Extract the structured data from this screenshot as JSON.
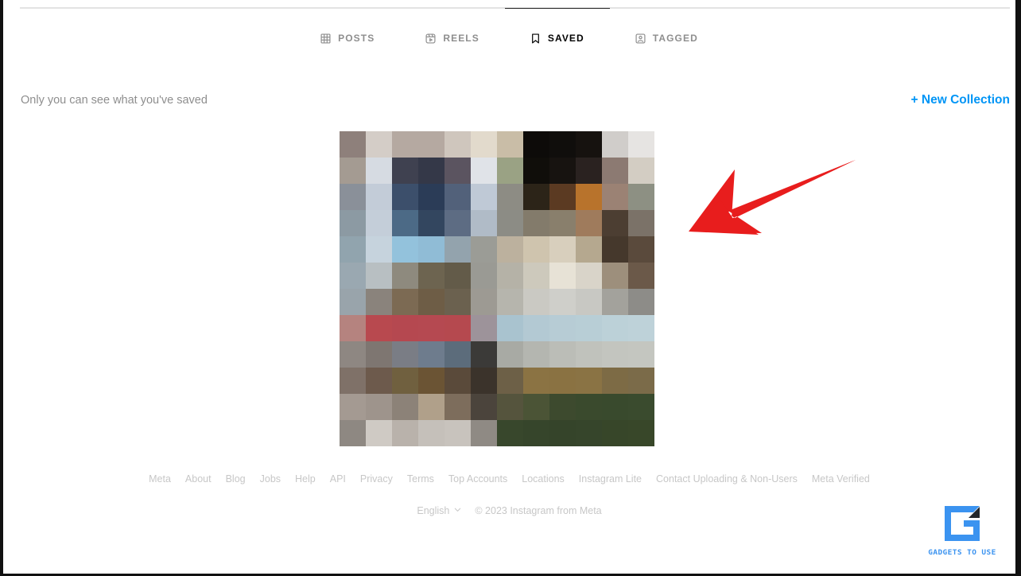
{
  "window": {
    "background": "#ffffff",
    "frame_color": "#111111"
  },
  "tabs": [
    {
      "id": "posts",
      "label": "POSTS",
      "icon": "grid-icon",
      "active": false
    },
    {
      "id": "reels",
      "label": "REELS",
      "icon": "reels-icon",
      "active": false
    },
    {
      "id": "saved",
      "label": "SAVED",
      "icon": "bookmark-icon",
      "active": true
    },
    {
      "id": "tagged",
      "label": "TAGGED",
      "icon": "tagged-icon",
      "active": false
    }
  ],
  "saved_section": {
    "privacy_note": "Only you can see what you've saved",
    "new_collection_label": "+ New Collection",
    "new_collection_color": "#0095f6",
    "items": [
      {
        "name": "saved-post-thumbnail",
        "state": "pixelated"
      }
    ]
  },
  "annotation": {
    "type": "arrow",
    "color": "#e81d1d",
    "direction": "down-left",
    "points_to": "saved-post-thumbnail"
  },
  "footer": {
    "links": [
      "Meta",
      "About",
      "Blog",
      "Jobs",
      "Help",
      "API",
      "Privacy",
      "Terms",
      "Top Accounts",
      "Locations",
      "Instagram Lite",
      "Contact Uploading & Non-Users",
      "Meta Verified"
    ],
    "language": "English",
    "copyright": "© 2023 Instagram from Meta"
  },
  "watermark": {
    "text": "GADGETS TO USE",
    "color": "#3b93f0"
  },
  "thumbnail_pixels": [
    [
      "#8e807b",
      "#d4cdc7",
      "#b5a9a1",
      "#b5a9a1",
      "#cfc6bd",
      "#e2dacc",
      "#c9bda7",
      "#0d0b09",
      "#100e0c",
      "#16120f",
      "#d0cdca",
      "#e6e4e2"
    ],
    [
      "#a49b92",
      "#d6dbe2",
      "#3f4150",
      "#343848",
      "#5b5460",
      "#e0e3e8",
      "#9aa284",
      "#100e0a",
      "#171310",
      "#2a2220",
      "#8c7a72",
      "#d3cdc3"
    ],
    [
      "#8a9099",
      "#c3ccd8",
      "#3c4f6b",
      "#2b3c57",
      "#52617a",
      "#bfc9d6",
      "#8d8c84",
      "#2c2418",
      "#5b3a22",
      "#b8732c",
      "#9b8274",
      "#8d9083"
    ],
    [
      "#8c9aa3",
      "#c4ced9",
      "#4c6a86",
      "#33465f",
      "#5d6c83",
      "#b0bbc7",
      "#8c8c85",
      "#837b6b",
      "#897f6c",
      "#9f7b5c",
      "#4c3e32",
      "#7b7268"
    ],
    [
      "#91a4ae",
      "#c6d3dd",
      "#93c2dc",
      "#90bcd6",
      "#93a3ad",
      "#9b9c96",
      "#bcb19e",
      "#cfc4ae",
      "#d8cfbd",
      "#b5a88f",
      "#45382c",
      "#5a4a3c"
    ],
    [
      "#9aa8b1",
      "#b8bfc2",
      "#8e8a7e",
      "#6d6450",
      "#635b49",
      "#9a9a94",
      "#b5b2a7",
      "#cdc9bc",
      "#e7e2d6",
      "#d9d4c9",
      "#9d8f7c",
      "#6b5949"
    ],
    [
      "#99a4ab",
      "#8a837c",
      "#7c6a53",
      "#6e5d46",
      "#6b614f",
      "#9d9a93",
      "#b6b5ad",
      "#cac9c3",
      "#cfcfca",
      "#c8c8c3",
      "#a3a29c",
      "#8d8c88"
    ],
    [
      "#b5837f",
      "#b8494f",
      "#b54850",
      "#b54951",
      "#b5494f",
      "#9d939a",
      "#a9c3cf",
      "#b3c9d3",
      "#b7ccd5",
      "#b8ced6",
      "#bcd1d8",
      "#bed2d9"
    ],
    [
      "#8e8782",
      "#7e7671",
      "#7a7d85",
      "#6e7c8d",
      "#5c6c7b",
      "#3b3a38",
      "#a8aaa4",
      "#b4b6b0",
      "#bbbdb7",
      "#c0c2bc",
      "#c3c5bf",
      "#c4c6c0"
    ],
    [
      "#7f7168",
      "#6d5a4c",
      "#70603f",
      "#6b5434",
      "#5a4a3a",
      "#3b332b",
      "#6d6047",
      "#8b7343",
      "#8a7242",
      "#8a7344",
      "#7d6b45",
      "#7b6b49"
    ],
    [
      "#a49a92",
      "#9e948c",
      "#8c8278",
      "#b0a08a",
      "#7d6d5c",
      "#4b443c",
      "#55543d",
      "#4b5436",
      "#3d4a2e",
      "#3a4a2d",
      "#394a2d",
      "#3a4b2e"
    ],
    [
      "#8e8882",
      "#cfcac4",
      "#b9b2ab",
      "#c5c0ba",
      "#c8c3bd",
      "#8f8a84",
      "#38472c",
      "#36452b",
      "#35442a",
      "#36452b",
      "#374629",
      "#384729"
    ]
  ]
}
